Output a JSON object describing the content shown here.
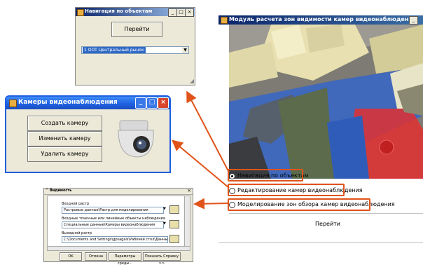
{
  "nav_window": {
    "title": "Навигация по объектам",
    "go_button": "Перейти",
    "selected_object": "1 ООТ Центральный рынок"
  },
  "module_window": {
    "title": "Модуль расчета зон видимости камер видеонаблюдения",
    "options": [
      "Навигация по объектам",
      "Редактирование камер видеонаблюдения",
      "Моделирование зон обзора камер видеонаблюдения"
    ],
    "selected_option": 0,
    "go_button": "Перейти"
  },
  "cameras_window": {
    "title": "Камеры видеонаблюдения",
    "create_button": "Создать камеру",
    "edit_button": "Изменить камеру",
    "delete_button": "Удалить камеру"
  },
  "visibility_dialog": {
    "title": "Видимость",
    "input_raster_label": "Входной растр",
    "input_raster_value": "Растровые данные\\Растр для моделирования",
    "input_features_label": "Входные точечные или линейные объекты наблюдения",
    "input_features_value": "Специальные данные\\Камеры видеонаблюдения",
    "output_raster_label": "Выходной растр",
    "output_raster_value": "C:\\Documents and Settings\\gpsagals\\Рабочий стол\\Данные\\Растры\\",
    "ok_button": "OK",
    "cancel_button": "Отмена",
    "env_button": "Параметры среды...",
    "help_button": "Показать Справку >>"
  },
  "colors": {
    "arrow": "#e0541a",
    "xp_title": "#1f5fe0",
    "classic_title": "#0a246a"
  }
}
